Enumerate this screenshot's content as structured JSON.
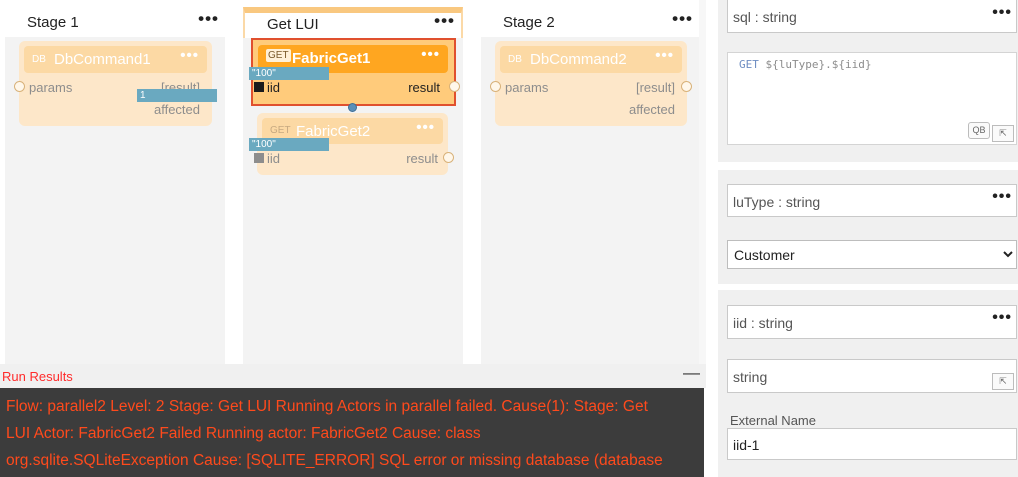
{
  "stages": [
    {
      "title": "Stage 1",
      "menu": "•••"
    },
    {
      "title": "Get LUI",
      "menu": "•••"
    },
    {
      "title": "Stage 2",
      "menu": "•••"
    }
  ],
  "actors": {
    "db1": {
      "badge": "DB",
      "name": "DbCommand1",
      "menu": "•••",
      "in_port": "params",
      "out_ports": [
        "[result]",
        "affected"
      ],
      "chip": "1"
    },
    "get1": {
      "badge": "GET",
      "name": "FabricGet1",
      "menu": "•••",
      "in_port": "iid",
      "out_port": "result",
      "chip": "\"100\""
    },
    "get2": {
      "badge": "GET",
      "name": "FabricGet2",
      "menu": "•••",
      "in_port": "iid",
      "out_port": "result",
      "chip": "\"100\""
    },
    "db2": {
      "badge": "DB",
      "name": "DbCommand2",
      "menu": "•••",
      "in_port": "params",
      "out_ports": [
        "[result]",
        "affected"
      ]
    }
  },
  "run_results": {
    "title": "Run Results",
    "minimize": "—",
    "lines": [
      "Flow: parallel2 Level: 2 Stage: Get LUI Running Actors in parallel failed. Cause(1): Stage: Get",
      "LUI Actor: FabricGet2 Failed Running actor: FabricGet2 Cause: class",
      "org.sqlite.SQLiteException Cause: [SQLITE_ERROR] SQL error or missing database (database"
    ]
  },
  "panel": {
    "sql": {
      "label": "sql : string",
      "menu": "•••",
      "code_kw": "GET",
      "code_rest": " ${luType}.${iid}",
      "qb_button": "QB",
      "expand_icon": "expand-corner-icon"
    },
    "lutype": {
      "label": "luType : string",
      "menu": "•••",
      "selected": "Customer"
    },
    "iid": {
      "label": "iid : string",
      "menu": "•••",
      "type_value": "string",
      "external_name_label": "External Name",
      "external_name_value": "iid-1",
      "expand_icon": "expand-corner-icon"
    }
  },
  "colors": {
    "accent": "#ffa620",
    "error_text": "#ff4a1c",
    "selection_border": "#e0502e",
    "chip": "#6aa9c0"
  }
}
